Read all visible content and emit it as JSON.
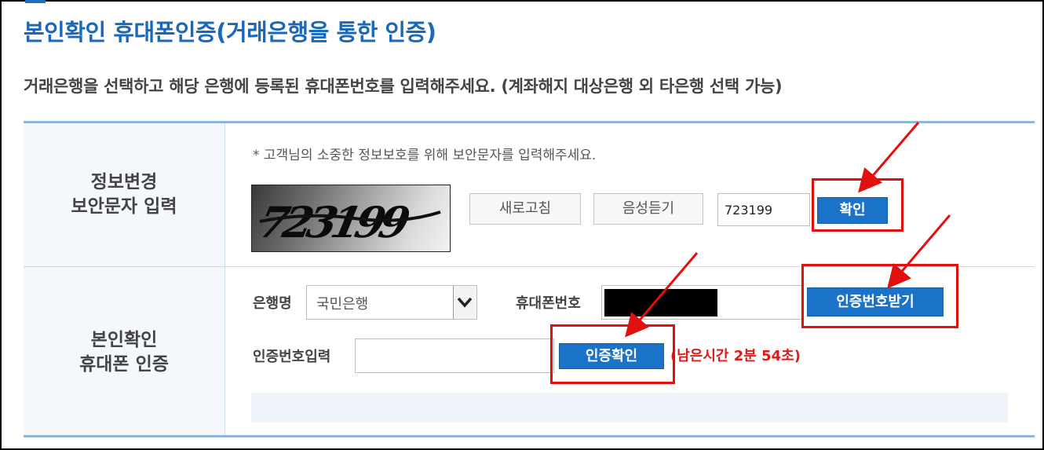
{
  "page": {
    "title": "본인확인 휴대폰인증(거래은행을 통한 인증)",
    "instruction": "거래은행을 선택하고 해당 은행에 등록된 휴대폰번호를 입력해주세요. (계좌해지 대상은행 외 타은행 선택 가능)"
  },
  "security_row": {
    "header_line1": "정보변경",
    "header_line2": "보안문자 입력",
    "note": "* 고객님의 소중한 정보보호를 위해 보안문자를 입력해주세요.",
    "captcha_text": "723199",
    "refresh_label": "새로고침",
    "audio_label": "음성듣기",
    "input_value": "723199",
    "confirm_label": "확인"
  },
  "verify_row": {
    "header_line1": "본인확인",
    "header_line2": "휴대폰 인증",
    "bank_label": "은행명",
    "bank_selected": "국민은행",
    "phone_label": "휴대폰번호",
    "request_code_label": "인증번호받기",
    "code_label": "인증번호입력",
    "code_value": "",
    "verify_label": "인증확인",
    "timer_text": "(남은시간 2분 54초)"
  },
  "colors": {
    "title": "#1a68b7",
    "primary_button": "#1b72c9",
    "annotation": "#e20f0f",
    "timer": "#e01919"
  },
  "icons": {
    "select_arrow": "chevron-down-icon",
    "annotation_arrow": "red-arrow-icon"
  }
}
